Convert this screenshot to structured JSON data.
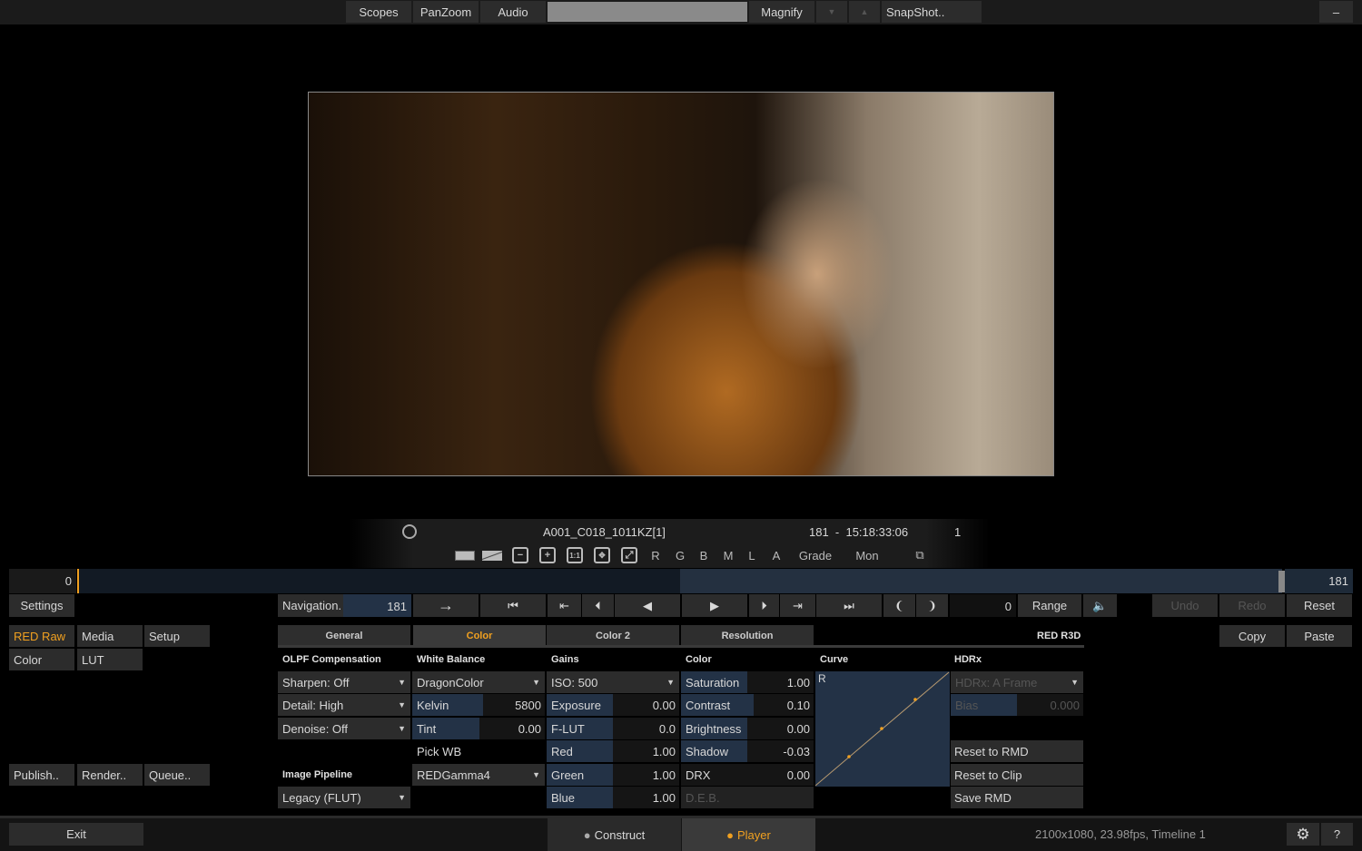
{
  "topbar": {
    "scopes": "Scopes",
    "panzoom": "PanZoom",
    "audio": "Audio",
    "magnify": "Magnify",
    "down": "▼",
    "up": "▲",
    "snapshot": "SnapShot..",
    "minimize": "–"
  },
  "viewer": {
    "clip_name": "A001_C018_1011KZ[1]",
    "frame_tc": "181  -  15:18:33:06",
    "count": "1",
    "channels": [
      "R",
      "G",
      "B",
      "M",
      "L",
      "A"
    ],
    "grade": "Grade",
    "mon": "Mon",
    "zoom_1to1": "1:1"
  },
  "timeline": {
    "start": "0",
    "end": "181",
    "progress_percent": 50
  },
  "transport": {
    "settings": "Settings",
    "navigation": "Navigation.",
    "frame": "181",
    "go": "→",
    "in_field": "0",
    "range": "Range",
    "undo": "Undo",
    "redo": "Redo",
    "reset": "Reset"
  },
  "left_tabs": {
    "red_raw": "RED Raw",
    "media": "Media",
    "setup": "Setup",
    "color": "Color",
    "lut": "LUT",
    "publish": "Publish..",
    "render": "Render..",
    "queue": "Queue..",
    "exit": "Exit"
  },
  "panel": {
    "tabs": [
      "General",
      "Color",
      "Color 2",
      "Resolution"
    ],
    "active_tab": "Color",
    "format": "RED R3D",
    "olpf": {
      "title": "OLPF Compensation",
      "sharpen": "Sharpen: Off",
      "detail": "Detail: High",
      "denoise": "Denoise: Off"
    },
    "pipeline": {
      "title": "Image Pipeline",
      "value": "Legacy (FLUT)"
    },
    "wb": {
      "title": "White Balance",
      "colorspace": "DragonColor",
      "kelvin_label": "Kelvin",
      "kelvin": "5800",
      "tint_label": "Tint",
      "tint": "0.00",
      "pick": "Pick WB",
      "gamma": "REDGamma4"
    },
    "gains": {
      "title": "Gains",
      "iso": "ISO: 500",
      "exposure_label": "Exposure",
      "exposure": "0.00",
      "flut_label": "F-LUT",
      "flut": "0.0",
      "red_label": "Red",
      "red": "1.00",
      "green_label": "Green",
      "green": "1.00",
      "blue_label": "Blue",
      "blue": "1.00"
    },
    "color": {
      "title": "Color",
      "saturation_label": "Saturation",
      "saturation": "1.00",
      "contrast_label": "Contrast",
      "contrast": "0.10",
      "brightness_label": "Brightness",
      "brightness": "0.00",
      "shadow_label": "Shadow",
      "shadow": "-0.03",
      "drx_label": "DRX",
      "drx": "0.00",
      "deb": "D.E.B."
    },
    "curve": {
      "title": "Curve",
      "channel": "R"
    },
    "hdrx": {
      "title": "HDRx",
      "mode": "HDRx: A Frame",
      "bias_label": "Bias",
      "bias": "0.000",
      "reset_rmd": "Reset to RMD",
      "reset_clip": "Reset to Clip",
      "save_rmd": "Save RMD"
    }
  },
  "copy": "Copy",
  "paste": "Paste",
  "bottom": {
    "construct": "Construct",
    "player": "Player",
    "status": "2100x1080, 23.98fps, Timeline 1",
    "help": "?"
  },
  "colors": {
    "accent": "#f0a020",
    "field": "#233246"
  }
}
